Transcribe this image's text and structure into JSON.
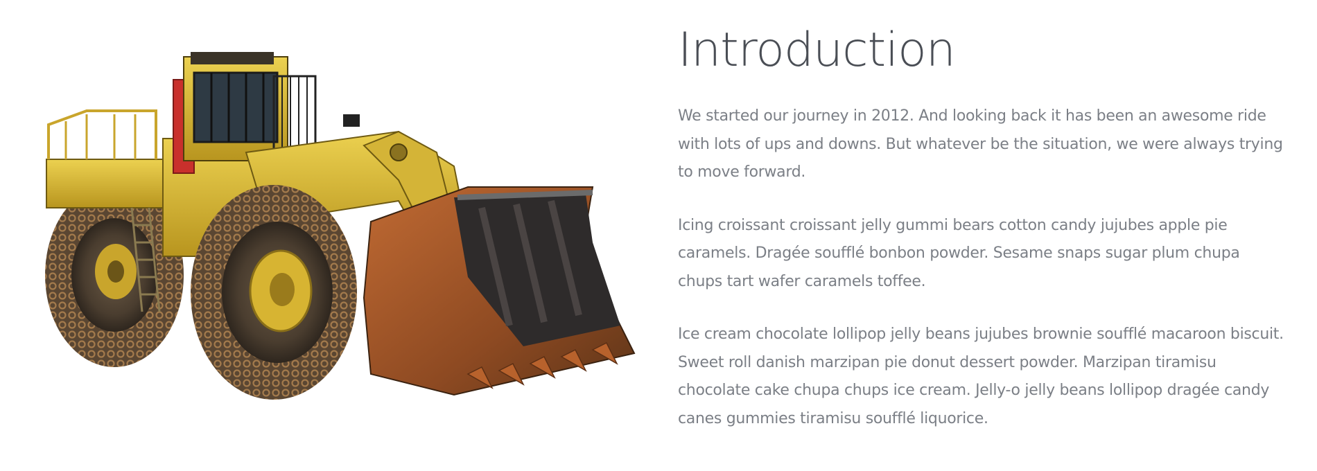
{
  "intro": {
    "title": "Introduction",
    "paragraphs": [
      "We started our journey in 2012. And looking back it has been an awesome ride with lots of ups and downs. But whatever be the situation, we were always trying to move forward.",
      "Icing croissant croissant jelly gummi bears cotton candy jujubes apple pie caramels. Dragée soufflé bonbon powder. Sesame snaps sugar plum chupa chups tart wafer caramels toffee.",
      "Ice cream chocolate lollipop jelly beans jujubes brownie soufflé macaroon biscuit. Sweet roll danish marzipan pie donut dessert powder. Marzipan tiramisu chocolate cake chupa chups ice cream. Jelly-o jelly beans lollipop dragée candy canes gummies tiramisu soufflé liquorice."
    ]
  },
  "image": {
    "subject": "wheel-loader",
    "colors": {
      "body": "#e2c23a",
      "body_shade": "#b8951f",
      "tire": "#4a3f33",
      "chain": "#8a6a45",
      "bucket_rust": "#a8582a",
      "bucket_dark": "#2a2a2c",
      "cab_red": "#c9302c"
    }
  }
}
